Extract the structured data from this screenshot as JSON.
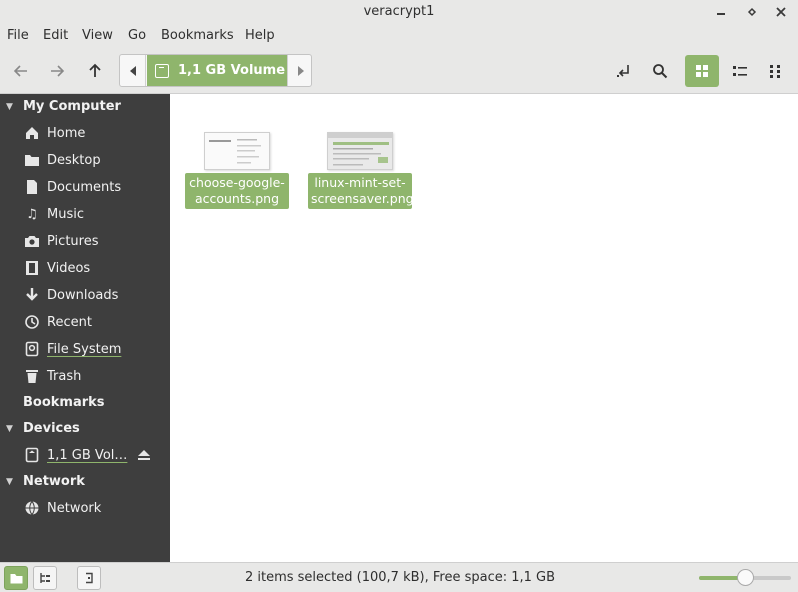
{
  "window": {
    "title": "veracrypt1"
  },
  "menu": [
    "File",
    "Edit",
    "View",
    "Go",
    "Bookmarks",
    "Help"
  ],
  "toolbar": {
    "path_current": "1,1 GB Volume"
  },
  "sidebar": {
    "sections": [
      {
        "title": "My Computer",
        "items": [
          {
            "label": "Home",
            "icon": "home-icon"
          },
          {
            "label": "Desktop",
            "icon": "folder-icon"
          },
          {
            "label": "Documents",
            "icon": "document-icon"
          },
          {
            "label": "Music",
            "icon": "music-icon"
          },
          {
            "label": "Pictures",
            "icon": "camera-icon"
          },
          {
            "label": "Videos",
            "icon": "film-icon"
          },
          {
            "label": "Downloads",
            "icon": "download-icon"
          },
          {
            "label": "Recent",
            "icon": "recent-icon"
          },
          {
            "label": "File System",
            "icon": "drive-icon"
          },
          {
            "label": "Trash",
            "icon": "trash-icon"
          }
        ]
      },
      {
        "title": "Bookmarks",
        "items": []
      },
      {
        "title": "Devices",
        "items": [
          {
            "label": "1,1 GB Vol…",
            "icon": "drive-icon",
            "eject": true
          }
        ]
      },
      {
        "title": "Network",
        "items": [
          {
            "label": "Network",
            "icon": "network-icon"
          }
        ]
      }
    ]
  },
  "files": [
    {
      "name": "choose-google-accounts.png",
      "label_line1": "choose-google-",
      "label_line2": "accounts.png",
      "selected": true
    },
    {
      "name": "linux-mint-set-screensaver.png",
      "label_line1": "linux-mint-set-",
      "label_line2": "screensaver.png",
      "selected": true
    }
  ],
  "status": {
    "text": "2 items selected (100,7 kB), Free space: 1,1 GB",
    "zoom_level": 0.5
  },
  "colors": {
    "accent": "#8fb56c",
    "sidebar_bg": "#3e3e3e",
    "chrome_bg": "#e8e8e7"
  }
}
